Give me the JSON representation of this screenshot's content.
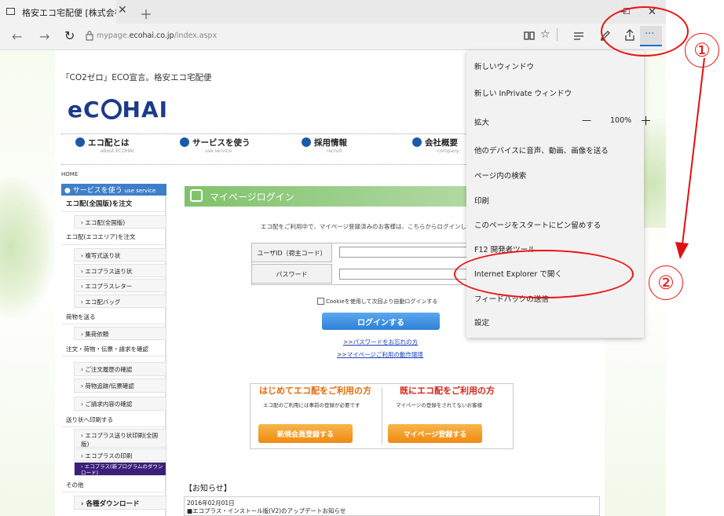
{
  "browser": {
    "tab_title": "格安エコ宅配便 [株式会社",
    "tab_close": "✕",
    "new_tab": "＋",
    "url_prefix": "mypage.",
    "url_domain": "ecohai.co.jp",
    "url_path": "/index.aspx",
    "win_min": "−",
    "win_max": "☐",
    "win_close": "✕",
    "back": "←",
    "forward": "→",
    "refresh": "↻",
    "more": "···"
  },
  "page": {
    "eco_message": "「CO2ゼロ」ECO宣言。格安エコ宅配便",
    "logo_left": "eC",
    "logo_right": "HAI",
    "gnav": [
      {
        "label": "エコ配とは",
        "sub": "about ECOHAI"
      },
      {
        "label": "サービスを使う",
        "sub": "use service"
      },
      {
        "label": "採用情報",
        "sub": "recruit"
      },
      {
        "label": "会社概要",
        "sub": "company"
      }
    ],
    "breadcrumb": "HOME",
    "sidebar": {
      "head": "サービスを使う",
      "head_en": "use service",
      "items": [
        "エコ配(全国版)を注文",
        "› エコ配(全国版)",
        "エコ配(エコエリア)を注文",
        "› 複写式送り状",
        "› エコプラス送り状",
        "› エコプラスレター",
        "› エコ配バッグ",
        "荷物を送る",
        "› 集荷依頼",
        "注文・荷物・伝票・請求を確認",
        "› ご注文履歴の確認",
        "› 荷物追跡/伝票確認",
        "› ご請求内容の確認",
        "送り状へ印刷する",
        "› エコプラス送り状印刷(全国版)",
        "› エコプラスの印刷",
        "› エコプラス(新プログラムのダウンロード)",
        "その他",
        "› 各種ダウンロード"
      ]
    },
    "mypage_title": "マイページログイン",
    "mypage_msg": "エコ配をご利用中で、マイページ登録済みのお客様は、こちらからログインし",
    "user_label": "ユーザID（荷主コード）",
    "pass_label": "パスワード",
    "cookie_label": "Cookieを使用して次回より自動ログインする",
    "login_btn": "ログインする",
    "link1_prefix": ">>",
    "link1": "パスワードをお忘れの方",
    "link2_prefix": ">>",
    "link2": "マイページご利用の動作環境",
    "banner_left_title": "はじめてエコ配をご利用の方",
    "banner_left_sub": "エコ配のご利用には事前の登録が必要です",
    "banner_left_btn": "新規会員登録する",
    "banner_right_title": "既にエコ配をご利用の方",
    "banner_right_sub": "マイページの登録をされてないお客様",
    "banner_right_btn": "マイページ登録する",
    "news_title": "【お知らせ】",
    "news_date": "2016年02月01日",
    "news_item": "■エコプラス・インストール版(V2)のアップデートお知らせ"
  },
  "menu": {
    "items": [
      "新しいウィンドウ",
      "新しい InPrivate ウィンドウ",
      "拡大",
      "他のデバイスに音声、動画、画像を送る",
      "ページ内の検索",
      "印刷",
      "このページをスタートにピン留めする",
      "F12 開発者ツール",
      "Internet Explorer で開く",
      "フィードバックの送信",
      "設定"
    ],
    "zoom_minus": "—",
    "zoom_value": "100%",
    "zoom_plus": "＋"
  },
  "annotations": {
    "num1": "①",
    "num2": "②"
  },
  "colors": {
    "annotation": "#e11111",
    "logo": "#1b3a8a",
    "login_button": "#2f7fd6",
    "register_button": "#ee8a12"
  }
}
